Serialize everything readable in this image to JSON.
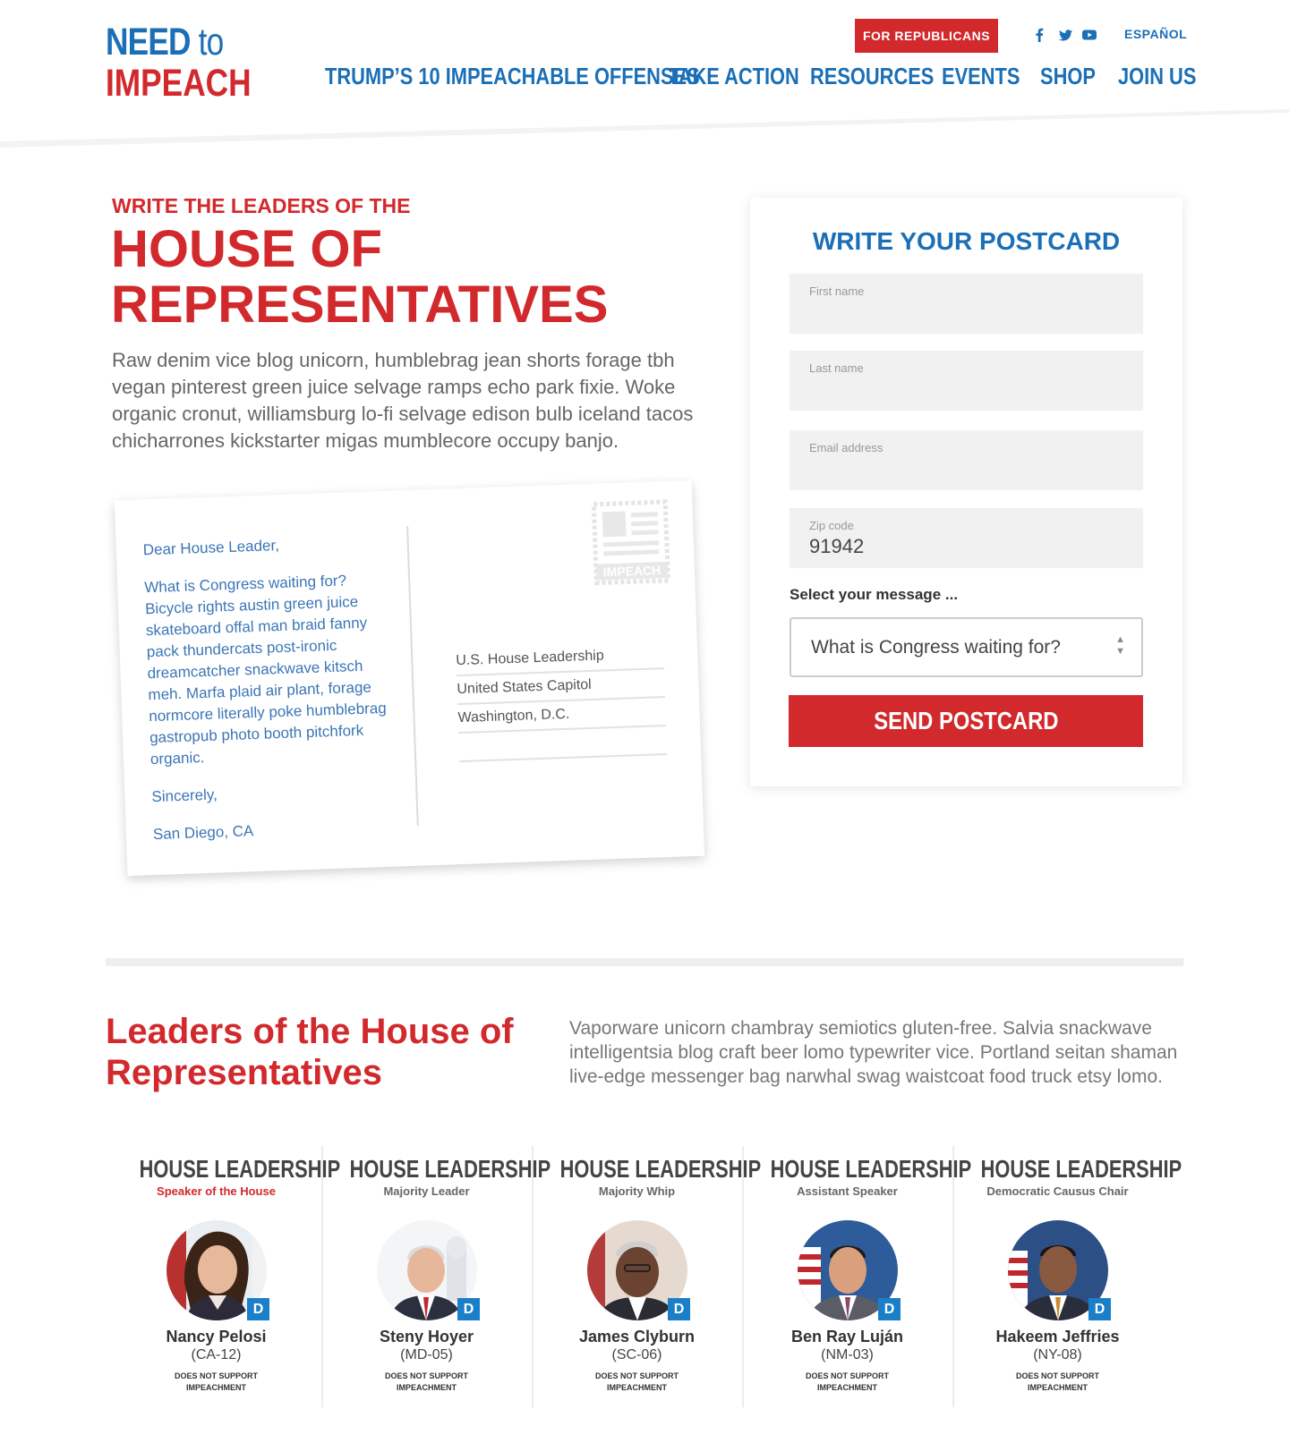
{
  "header": {
    "logo_line1": "NEED",
    "logo_to": "to",
    "logo_line2": "IMPEACH",
    "republicans_button": "FOR REPUBLICANS",
    "language_link": "ESPAÑOL",
    "social_icons": [
      "facebook-icon",
      "twitter-icon",
      "youtube-icon"
    ],
    "nav": [
      "TRUMP’S 10 IMPEACHABLE OFFENSES",
      "TAKE ACTION",
      "RESOURCES",
      "EVENTS",
      "SHOP",
      "JOIN US"
    ]
  },
  "hero": {
    "kicker": "WRITE THE LEADERS OF THE",
    "title": "HOUSE OF REPRESENTATIVES",
    "body": "Raw denim vice blog unicorn, humblebrag jean shorts forage tbh vegan pinterest green juice selvage ramps echo park fixie. Woke organic cronut, williamsburg lo-fi selvage edison bulb iceland tacos chicharrones kickstarter migas mumblecore occupy banjo."
  },
  "postcard": {
    "greeting": "Dear House Leader,",
    "message": "What is Congress waiting for? Bicycle rights austin green juice skateboard offal man braid fanny pack thundercats post-ironic dreamcatcher snackwave kitsch meh. Marfa plaid air plant, forage normcore literally poke humblebrag gastropub photo booth pitchfork organic.",
    "closing": "Sincerely,",
    "location": "San Diego, CA",
    "stamp_text": "IMPEACH",
    "address": [
      "U.S. House Leadership",
      "United States Capitol",
      "Washington, D.C."
    ]
  },
  "form": {
    "title": "WRITE YOUR POSTCARD",
    "first_name": {
      "placeholder": "First name",
      "value": ""
    },
    "last_name": {
      "placeholder": "Last name",
      "value": ""
    },
    "email": {
      "placeholder": "Email address",
      "value": ""
    },
    "zip": {
      "placeholder": "Zip code",
      "value": "91942"
    },
    "select_label": "Select your message ...",
    "select_value": "What is Congress waiting for?",
    "submit": "SEND POSTCARD"
  },
  "leaders_section": {
    "title": "Leaders of the House of Representatives",
    "body": "Vaporware unicorn chambray semiotics gluten-free. Salvia snackwave intelligentsia blog craft beer lomo typewriter vice. Portland seitan shaman live-edge messenger bag narwhal swag waistcoat food truck etsy lomo."
  },
  "leaders": [
    {
      "heading": "HOUSE LEADERSHIP",
      "role": "Speaker of the House",
      "name": "Nancy Pelosi",
      "district": "(CA-12)",
      "party": "D",
      "status": "DOES NOT SUPPORT IMPEACHMENT"
    },
    {
      "heading": "HOUSE LEADERSHIP",
      "role": "Majority Leader",
      "name": "Steny Hoyer",
      "district": "(MD-05)",
      "party": "D",
      "status": "DOES NOT SUPPORT IMPEACHMENT"
    },
    {
      "heading": "HOUSE LEADERSHIP",
      "role": "Majority Whip",
      "name": "James Clyburn",
      "district": "(SC-06)",
      "party": "D",
      "status": "DOES NOT SUPPORT IMPEACHMENT"
    },
    {
      "heading": "HOUSE LEADERSHIP",
      "role": "Assistant Speaker",
      "name": "Ben Ray Luján",
      "district": "(NM-03)",
      "party": "D",
      "status": "DOES NOT SUPPORT IMPEACHMENT"
    },
    {
      "heading": "HOUSE LEADERSHIP",
      "role": "Democratic Causus Chair",
      "name": "Hakeem Jeffries",
      "district": "(NY-08)",
      "party": "D",
      "status": "DOES NOT SUPPORT IMPEACHMENT"
    }
  ],
  "colors": {
    "brand_blue": "#1a6fb6",
    "brand_red": "#d2292d",
    "party_badge": "#1a7fc8"
  }
}
